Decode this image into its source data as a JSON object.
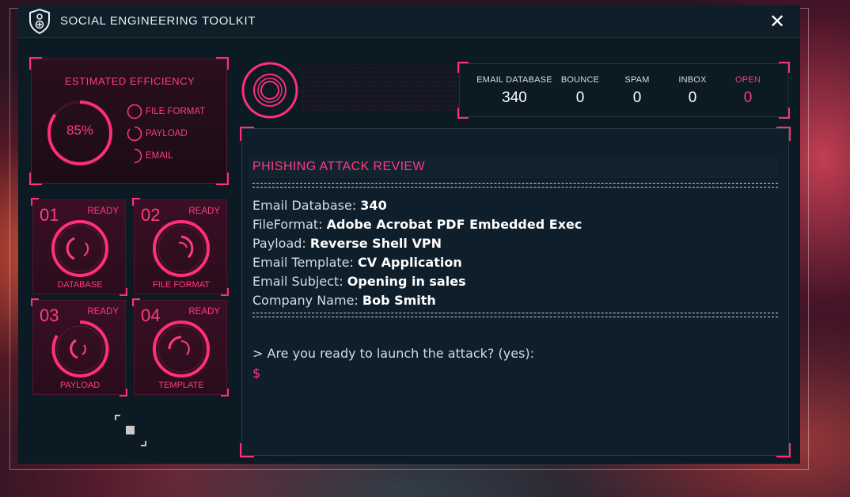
{
  "window": {
    "title": "SOCIAL ENGINEERING TOOLKIT",
    "close_label": "✕"
  },
  "efficiency": {
    "title": "ESTIMATED EFFICIENCY",
    "percent_label": "85%",
    "percent_value": 85,
    "checklist": [
      {
        "label": "FILE FORMAT"
      },
      {
        "label": "PAYLOAD"
      },
      {
        "label": "EMAIL"
      }
    ]
  },
  "modules": [
    {
      "num": "01",
      "status": "READY",
      "label": "DATABASE"
    },
    {
      "num": "02",
      "status": "READY",
      "label": "FILE FORMAT"
    },
    {
      "num": "03",
      "status": "READY",
      "label": "PAYLOAD"
    },
    {
      "num": "04",
      "status": "READY",
      "label": "TEMPLATE"
    }
  ],
  "stats": [
    {
      "label": "EMAIL DATABASE",
      "value": "340"
    },
    {
      "label": "BOUNCE",
      "value": "0"
    },
    {
      "label": "SPAM",
      "value": "0"
    },
    {
      "label": "INBOX",
      "value": "0"
    },
    {
      "label": "OPEN",
      "value": "0"
    }
  ],
  "terminal": {
    "header": "PHISHING ATTACK REVIEW",
    "rows": [
      {
        "key": "Email Database: ",
        "value": "340"
      },
      {
        "key": "FileFormat: ",
        "value": "Adobe Acrobat PDF Embedded Exec"
      },
      {
        "key": "Payload: ",
        "value": "Reverse Shell VPN"
      },
      {
        "key": "Email Template: ",
        "value": "CV Application"
      },
      {
        "key": "Email Subject: ",
        "value": "Opening in sales"
      },
      {
        "key": "Company Name: ",
        "value": "Bob Smith"
      }
    ],
    "prompt": "> Are you ready to launch the attack? (yes):",
    "input_symbol": "$",
    "input_value": ""
  },
  "colors": {
    "accent": "#ff3c7e",
    "bracket": "#ff2f78",
    "window_bg": "#0a1922",
    "text": "#d6dde2"
  }
}
